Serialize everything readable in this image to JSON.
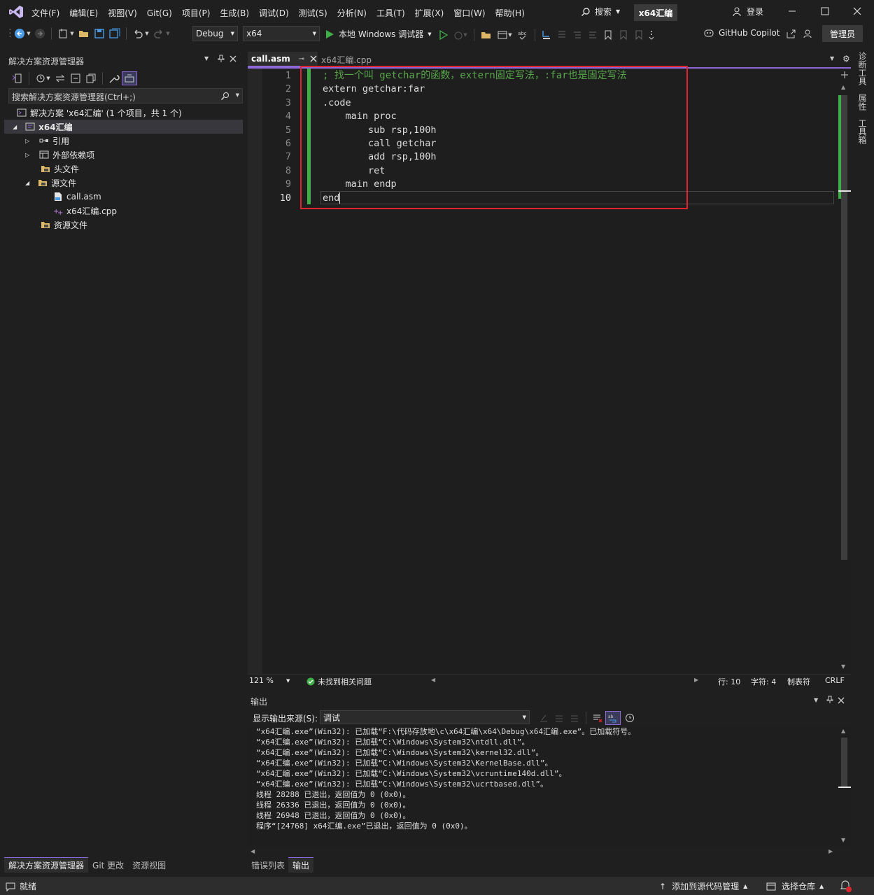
{
  "menubar": {
    "items": [
      "文件(F)",
      "编辑(E)",
      "视图(V)",
      "Git(G)",
      "项目(P)",
      "生成(B)",
      "调试(D)",
      "测试(S)",
      "分析(N)",
      "工具(T)",
      "扩展(X)",
      "窗口(W)",
      "帮助(H)"
    ],
    "search_label": "搜索",
    "solution_name": "x64汇编",
    "login_label": "登录"
  },
  "toolbar": {
    "config": "Debug",
    "platform": "x64",
    "run_label": "本地 Windows 调试器",
    "copilot_label": "GitHub Copilot",
    "admin_label": "管理员"
  },
  "solution_explorer": {
    "title": "解决方案资源管理器",
    "search_placeholder": "搜索解决方案资源管理器(Ctrl+;)",
    "solution_label": "解决方案 'x64汇编' (1 个项目，共 1 个)",
    "project": "x64汇编",
    "nodes": [
      "引用",
      "外部依赖项",
      "头文件",
      "源文件",
      "call.asm",
      "x64汇编.cpp",
      "资源文件"
    ],
    "bottom_tabs": [
      "解决方案资源管理器",
      "Git 更改",
      "资源视图"
    ]
  },
  "editor": {
    "tabs": [
      {
        "label": "call.asm",
        "active": true
      },
      {
        "label": "x64汇编.cpp",
        "active": false
      }
    ],
    "lines": [
      "; 找一个叫 getchar的函数，extern固定写法，:far也是固定写法",
      "extern getchar:far",
      ".code",
      "    main proc",
      "        sub rsp,100h",
      "        call getchar",
      "        add rsp,100h",
      "        ret",
      "    main endp",
      "end"
    ],
    "line_numbers": [
      "1",
      "2",
      "3",
      "4",
      "5",
      "6",
      "7",
      "8",
      "9",
      "10"
    ],
    "zoom": "121 %",
    "issues": "未找到相关问题",
    "row": "行: 10",
    "col": "字符: 4",
    "tabs_mode": "制表符",
    "eol": "CRLF",
    "side_tabs": [
      "诊断工具",
      "属性",
      "工具箱"
    ]
  },
  "output": {
    "title": "输出",
    "source_label": "显示输出来源(S):",
    "source_value": "调试",
    "lines": [
      "“x64汇编.exe”(Win32): 已加载“F:\\代码存放地\\c\\x64汇编\\x64\\Debug\\x64汇编.exe”。已加载符号。",
      "“x64汇编.exe”(Win32): 已加载“C:\\Windows\\System32\\ntdll.dll”。",
      "“x64汇编.exe”(Win32): 已加载“C:\\Windows\\System32\\kernel32.dll”。",
      "“x64汇编.exe”(Win32): 已加载“C:\\Windows\\System32\\KernelBase.dll”。",
      "“x64汇编.exe”(Win32): 已加载“C:\\Windows\\System32\\vcruntime140d.dll”。",
      "“x64汇编.exe”(Win32): 已加载“C:\\Windows\\System32\\ucrtbased.dll”。",
      "线程 28288 已退出，返回值为 0 (0x0)。",
      "线程 26336 已退出，返回值为 0 (0x0)。",
      "线程 26948 已退出，返回值为 0 (0x0)。",
      "程序“[24768] x64汇编.exe”已退出，返回值为 0 (0x0)。"
    ],
    "bottom_tabs": [
      "错误列表",
      "输出"
    ]
  },
  "statusbar": {
    "ready": "就绪",
    "add_source": "添加到源代码管理",
    "select_repo": "选择仓库"
  },
  "colors": {
    "accent": "#8e68d6",
    "highlight_box": "#e0242b",
    "change_bar": "#3fae49",
    "background": "#1f1f1f"
  }
}
